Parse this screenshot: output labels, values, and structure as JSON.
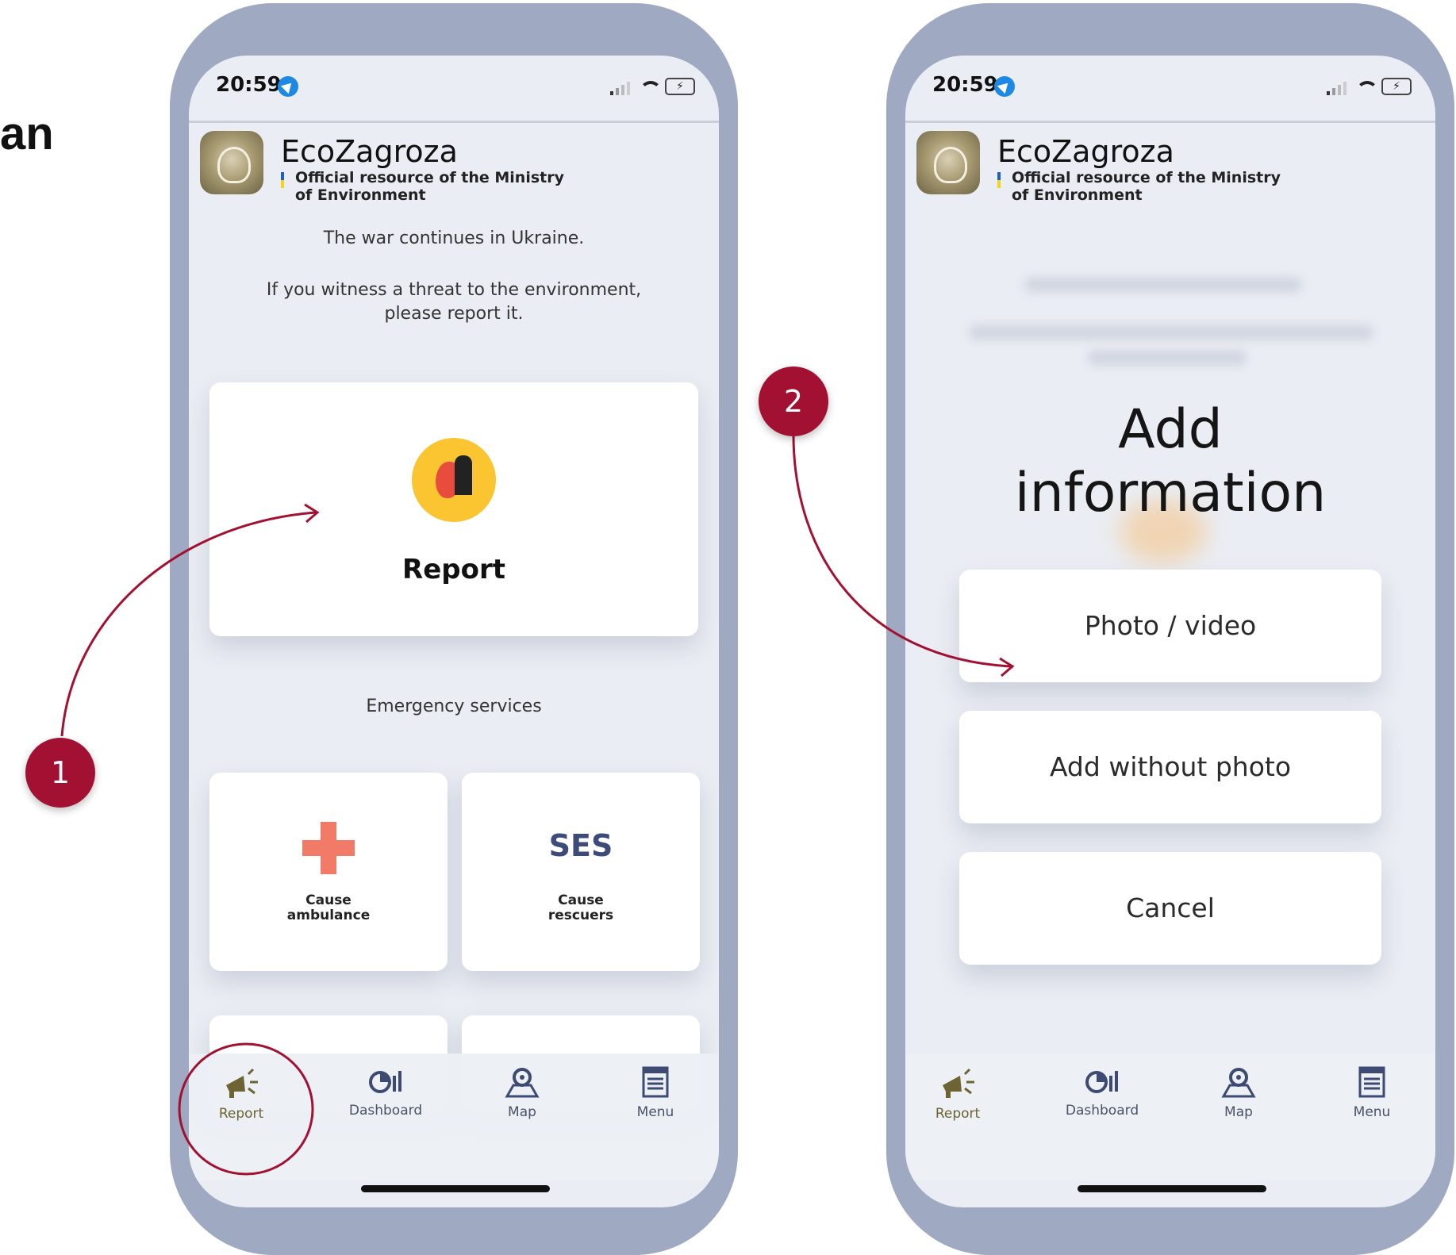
{
  "side_text": "an",
  "phones": [
    {
      "status": {
        "time": "20:59",
        "battery_glyph": "⚡"
      },
      "header": {
        "app_name": "EcoZagroza",
        "subtitle_line1": "Official resource of the Ministry",
        "subtitle_line2": "of Environment"
      },
      "intro": {
        "line1": "The war continues in Ukraine.",
        "line2": "If you witness a threat to the environment,",
        "line3": "please report it."
      },
      "report_card": {
        "label": "Report"
      },
      "emergency_heading": "Emergency services",
      "services": [
        {
          "label_line1": "Cause",
          "label_line2": "ambulance"
        },
        {
          "logo_text": "SES",
          "label_line1": "Cause",
          "label_line2": "rescuers"
        }
      ]
    },
    {
      "status": {
        "time": "20:59",
        "battery_glyph": "⚡"
      },
      "header": {
        "app_name": "EcoZagroza",
        "subtitle_line1": "Official resource of the Ministry",
        "subtitle_line2": "of Environment"
      },
      "sheet": {
        "title_line1": "Add",
        "title_line2": "information",
        "photo_button": "Photo / video",
        "no_photo_button": "Add without photo",
        "cancel_button": "Cancel"
      }
    }
  ],
  "tabbar": {
    "items": [
      {
        "label": "Report",
        "icon": "megaphone-icon"
      },
      {
        "label": "Dashboard",
        "icon": "dashboard-icon"
      },
      {
        "label": "Map",
        "icon": "map-pin-icon"
      },
      {
        "label": "Menu",
        "icon": "menu-list-icon"
      }
    ]
  },
  "callouts": [
    {
      "number": "1"
    },
    {
      "number": "2"
    }
  ],
  "colors": {
    "frame": "#a0a9c2",
    "screen_bg": "#eaedf3",
    "badge": "#a31132",
    "report_icon_bg": "#fbc531",
    "ambulance_cross": "#f27b68",
    "ses_text": "#3d4b7a",
    "flag_blue": "#1f5fbf",
    "flag_yellow": "#f7d21b"
  }
}
